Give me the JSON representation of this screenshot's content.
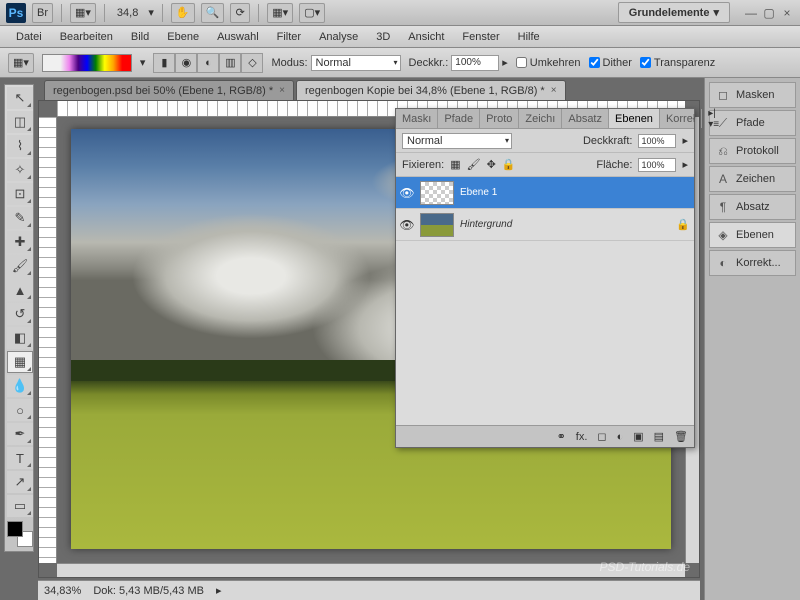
{
  "top": {
    "zoom": "34,8",
    "workspace": "Grundelemente"
  },
  "menu": [
    "Datei",
    "Bearbeiten",
    "Bild",
    "Ebene",
    "Auswahl",
    "Filter",
    "Analyse",
    "3D",
    "Ansicht",
    "Fenster",
    "Hilfe"
  ],
  "opt": {
    "modus_label": "Modus:",
    "modus_value": "Normal",
    "deckk_label": "Deckkr.:",
    "deckk_value": "100%",
    "umkehren": "Umkehren",
    "dither": "Dither",
    "transparenz": "Transparenz"
  },
  "tabs": [
    {
      "label": "regenbogen.psd bei 50% (Ebene 1, RGB/8) *"
    },
    {
      "label": "regenbogen Kopie bei 34,8% (Ebene 1, RGB/8) *"
    }
  ],
  "dock": [
    "Masken",
    "Pfade",
    "Protokoll",
    "Zeichen",
    "Absatz",
    "Ebenen",
    "Korrekt..."
  ],
  "layers_panel": {
    "tabs": [
      "Maskı",
      "Pfade",
      "Proto",
      "Zeichı",
      "Absatz",
      "Ebenen",
      "Korreł"
    ],
    "blend": "Normal",
    "deck_label": "Deckkraft:",
    "deck_value": "100%",
    "fix_label": "Fixieren:",
    "flaeche_label": "Fläche:",
    "flaeche_value": "100%",
    "layers": [
      {
        "name": "Ebene 1",
        "sel": true,
        "locked": false
      },
      {
        "name": "Hintergrund",
        "sel": false,
        "locked": true
      }
    ]
  },
  "status": {
    "zoom": "34,83%",
    "doc": "Dok: 5,43 MB/5,43 MB"
  },
  "watermark": "PSD-Tutorials.de"
}
